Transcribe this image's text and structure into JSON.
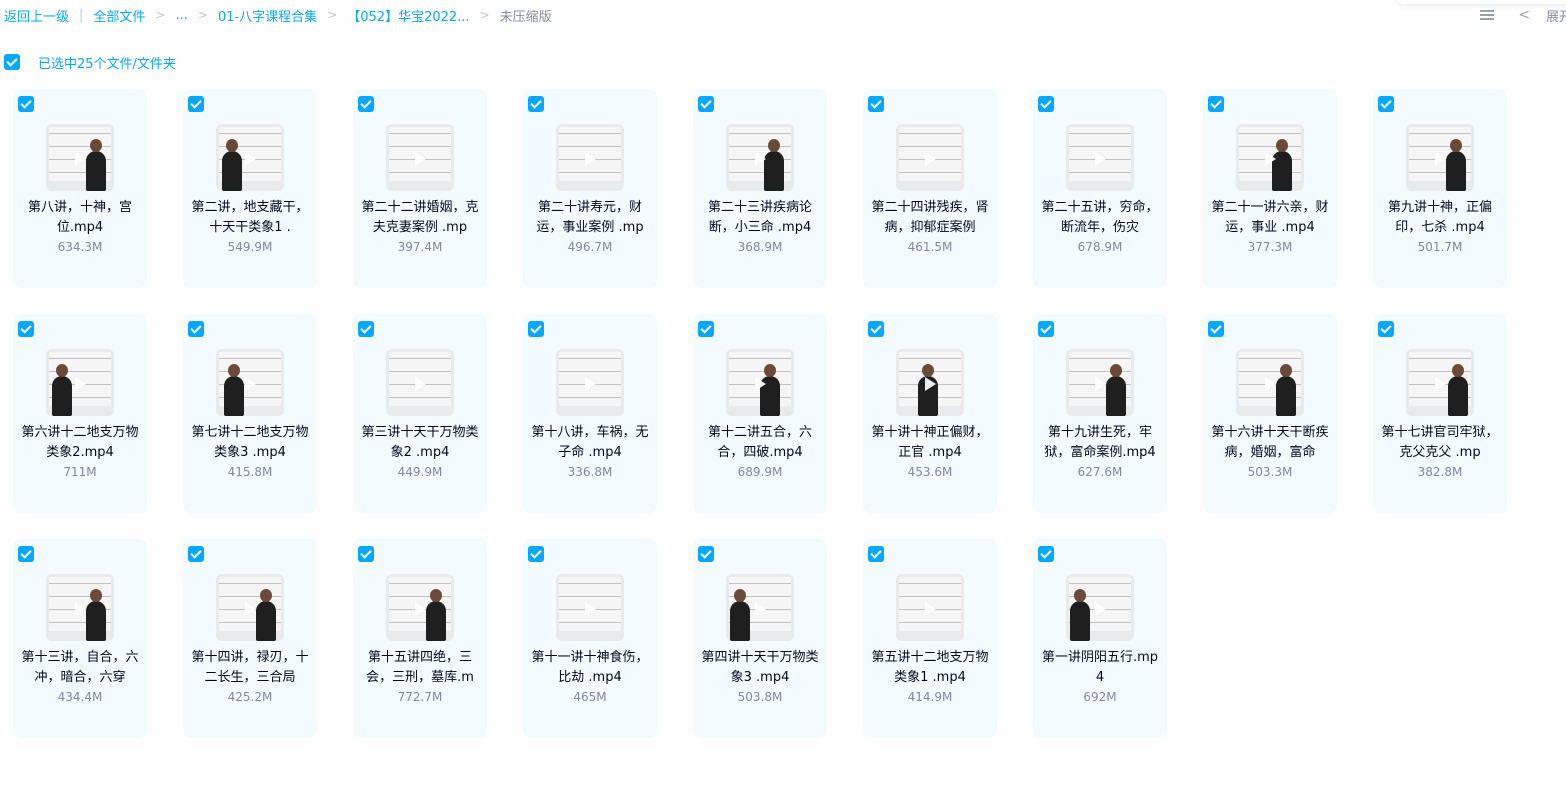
{
  "breadcrumb": {
    "back": "返回上一级",
    "root": "全部文件",
    "ellipsis": "...",
    "folder1": "01-八字课程合集",
    "folder2": "【052】华宝2022...",
    "current": "未压缩版"
  },
  "toolbar": {
    "expand_label": "展开"
  },
  "selection": {
    "label": "已选中25个文件/文件夹"
  },
  "files": [
    {
      "name": "第八讲，十神，宫位.mp4",
      "size": "634.3M"
    },
    {
      "name": "第二讲，地支藏干，十天干类象1 .",
      "size": "549.9M"
    },
    {
      "name": "第二十二讲婚姻，克夫克妻案例 .mp",
      "size": "397.4M"
    },
    {
      "name": "第二十讲寿元，财运，事业案例 .mp",
      "size": "496.7M"
    },
    {
      "name": "第二十三讲疾病论断，小三命 .mp4",
      "size": "368.9M"
    },
    {
      "name": "第二十四讲残疾，肾病，抑郁症案例",
      "size": "461.5M"
    },
    {
      "name": "第二十五讲，穷命，断流年，伤灾",
      "size": "678.9M"
    },
    {
      "name": "第二十一讲六亲，财运，事业 .mp4",
      "size": "377.3M"
    },
    {
      "name": "第九讲十神，正偏印，七杀 .mp4",
      "size": "501.7M"
    },
    {
      "name": "第六讲十二地支万物类象2.mp4",
      "size": "711M"
    },
    {
      "name": "第七讲十二地支万物类象3 .mp4",
      "size": "415.8M"
    },
    {
      "name": "第三讲十天干万物类象2 .mp4",
      "size": "449.9M"
    },
    {
      "name": "第十八讲，车祸，无子命 .mp4",
      "size": "336.8M"
    },
    {
      "name": "第十二讲五合，六合，四破.mp4",
      "size": "689.9M"
    },
    {
      "name": "第十讲十神正偏财，正官 .mp4",
      "size": "453.6M"
    },
    {
      "name": "第十九讲生死，牢狱，富命案例.mp4",
      "size": "627.6M"
    },
    {
      "name": "第十六讲十天干断疾病，婚姻，富命",
      "size": "503.3M"
    },
    {
      "name": "第十七讲官司牢狱，克父克父 .mp",
      "size": "382.8M"
    },
    {
      "name": "第十三讲，自合，六冲，暗合，六穿",
      "size": "434.4M"
    },
    {
      "name": "第十四讲，禄刃，十二长生，三合局",
      "size": "425.2M"
    },
    {
      "name": "第十五讲四绝，三会，三刑，墓库.m",
      "size": "772.7M"
    },
    {
      "name": "第十一讲十神食伤，比劫 .mp4",
      "size": "465M"
    },
    {
      "name": "第四讲十天干万物类象3 .mp4",
      "size": "503.8M"
    },
    {
      "name": "第五讲十二地支万物类象1 .mp4",
      "size": "414.9M"
    },
    {
      "name": "第一讲阴阳五行.mp4",
      "size": "692M"
    }
  ],
  "colors": {
    "accent": "#06a7ff",
    "card_bg": "#f4fbff",
    "text": "#03081a",
    "muted": "#818999"
  }
}
